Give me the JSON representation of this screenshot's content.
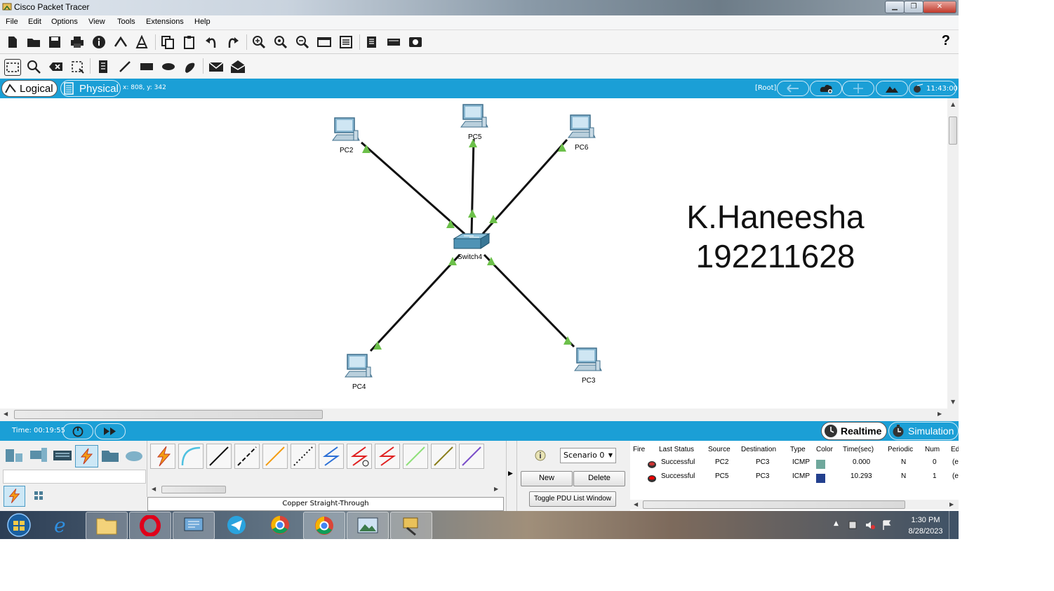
{
  "window": {
    "title": "Cisco Packet Tracer"
  },
  "menu": [
    "File",
    "Edit",
    "Options",
    "View",
    "Tools",
    "Extensions",
    "Help"
  ],
  "toolbar": {
    "help": "?"
  },
  "view_tabs": {
    "logical": "Logical",
    "physical": "Physical",
    "coords": "x: 808, y: 342",
    "root": "[Root]",
    "clock": "11:43:00"
  },
  "devices": [
    {
      "id": "pc2",
      "label": "PC2"
    },
    {
      "id": "pc5",
      "label": "PC5"
    },
    {
      "id": "pc6",
      "label": "PC6"
    },
    {
      "id": "switch4",
      "label": "Switch4"
    },
    {
      "id": "pc4",
      "label": "PC4"
    },
    {
      "id": "pc3",
      "label": "PC3"
    }
  ],
  "annotation": {
    "line1": "K.Haneesha",
    "line2": "192211628"
  },
  "status": {
    "time": "Time: 00:19:55",
    "realtime": "Realtime",
    "simulation": "Simulation"
  },
  "cable_panel": {
    "selected_cable": "Copper Straight-Through"
  },
  "pdu": {
    "scenario": "Scenario 0",
    "new": "New",
    "delete": "Delete",
    "toggle": "Toggle PDU List Window",
    "columns": [
      "Fire",
      "Last Status",
      "Source",
      "Destination",
      "Type",
      "Color",
      "Time(sec)",
      "Periodic",
      "Num",
      "Ed"
    ],
    "rows": [
      {
        "status": "Successful",
        "source": "PC2",
        "destination": "PC3",
        "type": "ICMP",
        "color": "#6fa89c",
        "time": "0.000",
        "periodic": "N",
        "num": "0",
        "edit": "(e"
      },
      {
        "status": "Successful",
        "source": "PC5",
        "destination": "PC3",
        "type": "ICMP",
        "color": "#23408e",
        "time": "10.293",
        "periodic": "N",
        "num": "1",
        "edit": "(e"
      }
    ]
  },
  "taskbar": {
    "time": "1:30 PM",
    "date": "8/28/2023"
  },
  "colors": {
    "accent": "#1b9fd6",
    "link_up": "#6cc04a"
  }
}
